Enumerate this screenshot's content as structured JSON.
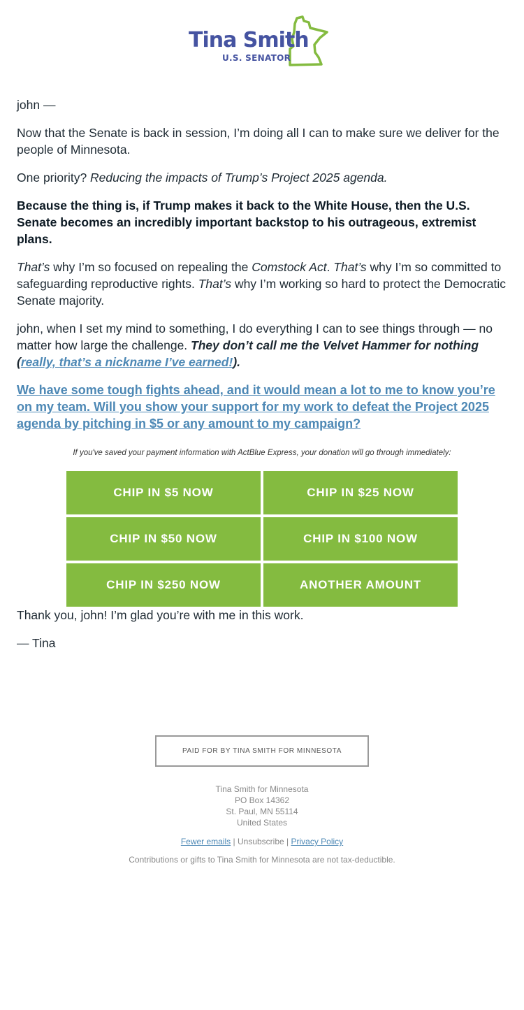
{
  "header": {
    "logo_name": "Tina Smith",
    "logo_subtitle": "U.S. SENATOR",
    "brand_blue": "#4553a1",
    "brand_green": "#84bb40"
  },
  "body": {
    "greeting": "john —",
    "p1": "Now that the Senate is back in session, I’m doing all I can to make sure we deliver for the people of Minnesota.",
    "p2_prefix": "One priority? ",
    "p2_italic": "Reducing the impacts of Trump’s Project 2025 agenda.",
    "p3_bold": "Because the thing is, if Trump makes it back to the White House, then the U.S. Senate becomes an incredibly important backstop to his outrageous, extremist plans.",
    "p4": {
      "i1": "That’s",
      "t1": " why I’m so focused on repealing the ",
      "i2": "Comstock Act",
      "t2": ". ",
      "i3": "That’s",
      "t3": " why I’m so committed to safeguarding reproductive rights. ",
      "i4": "That’s",
      "t4": " why I’m working so hard to protect the Democratic Senate majority."
    },
    "p5": {
      "text": "john, when I set my mind to something, I do everything I can to see things through — no matter how large the challenge. ",
      "bold_italic": "They don’t call me the Velvet Hammer for nothing",
      "paren_open": " (",
      "link": "really, that’s a nickname I’ve earned!",
      "paren_close": ")."
    },
    "cta_link": "We have some tough fights ahead, and it would mean a lot to me to know you’re on my team. Will you show your support for my work to defeat the Project 2025 agenda by pitching in $5 or any amount to my campaign?",
    "express_note": "If you've saved your payment information with ActBlue Express, your donation will go through immediately:",
    "buttons": [
      {
        "label": "CHIP IN $5 NOW"
      },
      {
        "label": "CHIP IN $25 NOW"
      },
      {
        "label": "CHIP IN $50 NOW"
      },
      {
        "label": "CHIP IN $100 NOW"
      },
      {
        "label": "CHIP IN $250 NOW"
      },
      {
        "label": "ANOTHER AMOUNT"
      }
    ],
    "thanks": "Thank you, john! I’m glad you’re with me in this work.",
    "signoff": "— Tina"
  },
  "footer": {
    "paid_for": "PAID FOR BY TINA SMITH FOR MINNESOTA",
    "address": [
      "Tina Smith for Minnesota",
      "PO Box 14362",
      "St. Paul, MN 55114",
      "United States"
    ],
    "links": {
      "fewer_emails": "Fewer emails",
      "sep": " | ",
      "unsubscribe": "Unsubscribe",
      "privacy": "Privacy Policy"
    },
    "disclaimer": "Contributions or gifts to Tina Smith for Minnesota are not tax-deductible."
  }
}
